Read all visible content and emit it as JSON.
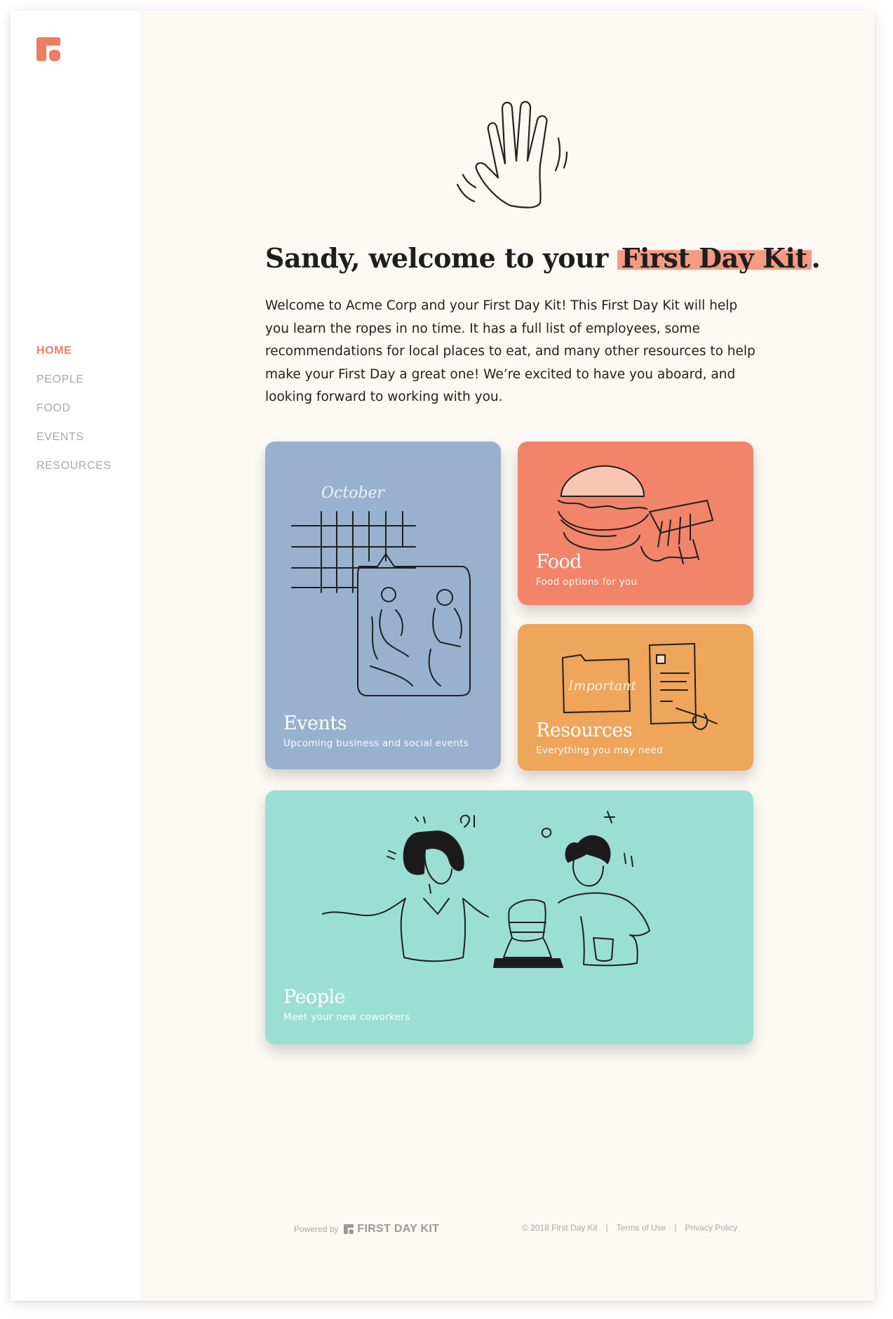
{
  "brand": {
    "accent": "#ef7c62",
    "logo_icon": "first-day-kit-logo-icon"
  },
  "sidebar": {
    "items": [
      {
        "label": "HOME",
        "active": true
      },
      {
        "label": "PEOPLE",
        "active": false
      },
      {
        "label": "FOOD",
        "active": false
      },
      {
        "label": "EVENTS",
        "active": false
      },
      {
        "label": "RESOURCES",
        "active": false
      }
    ]
  },
  "main": {
    "illustration": "waving-hand-icon",
    "headline_prefix": "Sandy, welcome to your ",
    "headline_highlight": "First Day Kit",
    "headline_suffix": ".",
    "intro": "Welcome to Acme Corp and your First Day Kit! This First Day Kit will help you learn the ropes in no time. It has a full list of employees, some recommendations for local places to eat, and many other resources to help make your First Day a great one! We’re excited to have you aboard, and looking forward to working with you."
  },
  "cards": {
    "events": {
      "title": "Events",
      "subtitle": "Upcoming business and social events",
      "color": "#99b1cf",
      "art_text": "October"
    },
    "food": {
      "title": "Food",
      "subtitle": "Food options for you",
      "color": "#f1846a"
    },
    "resources": {
      "title": "Resources",
      "subtitle": "Everything you may need",
      "color": "#eea55c",
      "art_text": "Important"
    },
    "people": {
      "title": "People",
      "subtitle": "Meet your new coworkers",
      "color": "#9bdfd2"
    }
  },
  "footer": {
    "powered_by": "Powered by",
    "brand": "FIRST DAY KIT",
    "copyright": "© 2018 First Day Kit",
    "sep": "|",
    "terms": "Terms of Use",
    "privacy": "Privacy Policy"
  }
}
